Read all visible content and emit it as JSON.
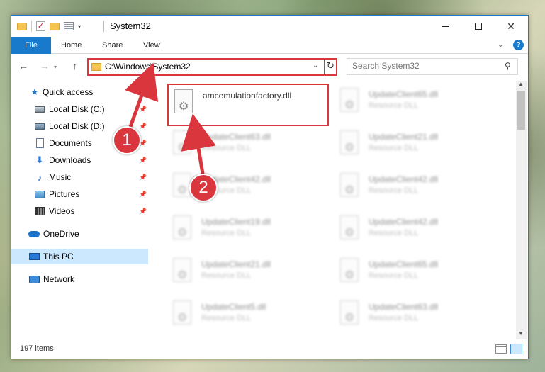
{
  "window": {
    "title": "System32"
  },
  "ribbon": {
    "tabs": [
      "File",
      "Home",
      "Share",
      "View"
    ]
  },
  "address": {
    "path": "C:\\Windows\\System32"
  },
  "search": {
    "placeholder": "Search System32"
  },
  "sidebar": {
    "items": [
      {
        "label": "Quick access",
        "icon": "star-icon",
        "pinned": false
      },
      {
        "label": "Local Disk (C:)",
        "icon": "drive-icon",
        "pinned": true
      },
      {
        "label": "Local Disk (D:)",
        "icon": "drive-icon",
        "pinned": true
      },
      {
        "label": "Documents",
        "icon": "documents-icon",
        "pinned": true
      },
      {
        "label": "Downloads",
        "icon": "download-icon",
        "pinned": true
      },
      {
        "label": "Music",
        "icon": "music-icon",
        "pinned": true
      },
      {
        "label": "Pictures",
        "icon": "pictures-icon",
        "pinned": true
      },
      {
        "label": "Videos",
        "icon": "videos-icon",
        "pinned": true
      },
      {
        "label": "OneDrive",
        "icon": "cloud-icon",
        "pinned": false
      },
      {
        "label": "This PC",
        "icon": "computer-icon",
        "pinned": false,
        "selected": true
      },
      {
        "label": "Network",
        "icon": "network-icon",
        "pinned": false
      }
    ]
  },
  "files": [
    {
      "name": "amcemulationfactory.dll",
      "type": ""
    },
    {
      "name": "UpdateClient65.dll",
      "type": "Resource DLL"
    },
    {
      "name": "UpdateClient63.dll",
      "type": "Resource DLL"
    },
    {
      "name": "UpdateClient21.dll",
      "type": "Resource DLL"
    },
    {
      "name": "UpdateClient42.dll",
      "type": "Resource DLL"
    },
    {
      "name": "UpdateClient42.dll",
      "type": "Resource DLL"
    },
    {
      "name": "UpdateClient19.dll",
      "type": "Resource DLL"
    },
    {
      "name": "UpdateClient42.dll",
      "type": "Resource DLL"
    },
    {
      "name": "UpdateClient21.dll",
      "type": "Resource DLL"
    },
    {
      "name": "UpdateClient65.dll",
      "type": "Resource DLL"
    },
    {
      "name": "UpdateClient5.dll",
      "type": "Resource DLL"
    },
    {
      "name": "UpdateClient63.dll",
      "type": "Resource DLL"
    }
  ],
  "status": {
    "item_count": "197 items"
  },
  "annotations": {
    "step1": "1",
    "step2": "2"
  },
  "colors": {
    "accent": "#1979ca",
    "highlight": "#d9363e",
    "selected": "#cce8ff"
  }
}
